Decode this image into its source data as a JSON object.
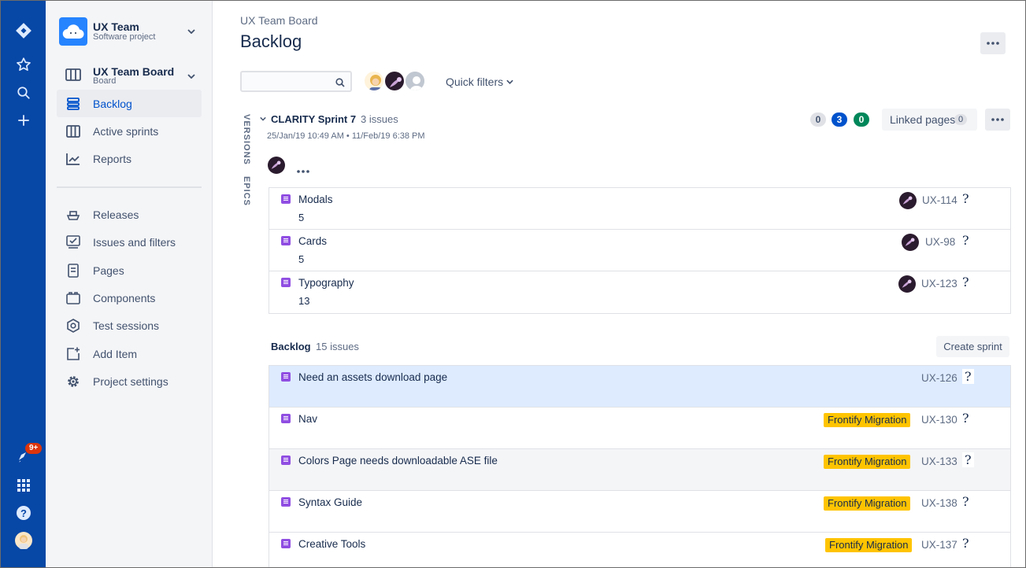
{
  "global_nav": {
    "notification_badge": "9+",
    "icons": [
      "jira-logo-icon",
      "star-icon",
      "search-icon",
      "plus-icon",
      "notification-icon",
      "app-switcher-icon",
      "help-icon",
      "user-avatar"
    ]
  },
  "sidebar": {
    "project": {
      "name": "UX Team",
      "type": "Software project"
    },
    "board": {
      "name": "UX Team Board",
      "type": "Board"
    },
    "items": [
      {
        "label": "Backlog",
        "icon": "backlog-icon",
        "active": true
      },
      {
        "label": "Active sprints",
        "icon": "board-icon",
        "active": false
      },
      {
        "label": "Reports",
        "icon": "reports-icon",
        "active": false
      },
      {
        "label": "Releases",
        "icon": "ship-icon",
        "active": false
      },
      {
        "label": "Issues and filters",
        "icon": "issues-icon",
        "active": false
      },
      {
        "label": "Pages",
        "icon": "page-icon",
        "active": false
      },
      {
        "label": "Components",
        "icon": "component-icon",
        "active": false
      },
      {
        "label": "Test sessions",
        "icon": "test-session-icon",
        "active": false
      },
      {
        "label": "Add Item",
        "icon": "add-item-icon",
        "active": false
      },
      {
        "label": "Project settings",
        "icon": "gear-icon",
        "active": false
      }
    ]
  },
  "header": {
    "breadcrumb": "UX Team Board",
    "title": "Backlog",
    "search_placeholder": "",
    "quick_filters": "Quick filters"
  },
  "side_tabs": {
    "versions": "VERSIONS",
    "epics": "EPICS"
  },
  "sprint": {
    "name": "CLARITY Sprint 7",
    "count": "3 issues",
    "dates": "25/Jan/19 10:49 AM • 11/Feb/19 6:38 PM",
    "status_counts": {
      "todo": "0",
      "in_progress": "3",
      "done": "0"
    },
    "linked_pages_label": "Linked pages",
    "linked_pages_count": "0",
    "issues": [
      {
        "summary": "Modals",
        "estimate": "5",
        "key": "UX-114"
      },
      {
        "summary": "Cards",
        "estimate": "5",
        "key": "UX-98"
      },
      {
        "summary": "Typography",
        "estimate": "13",
        "key": "UX-123"
      }
    ]
  },
  "backlog": {
    "title": "Backlog",
    "count": "15 issues",
    "create_sprint": "Create sprint",
    "issues": [
      {
        "summary": "Need an assets download page",
        "epic": "",
        "key": "UX-126"
      },
      {
        "summary": "Nav",
        "epic": "Frontify Migration",
        "key": "UX-130"
      },
      {
        "summary": "Colors Page needs downloadable ASE file",
        "epic": "Frontify Migration",
        "key": "UX-133"
      },
      {
        "summary": "Syntax Guide",
        "epic": "Frontify Migration",
        "key": "UX-138"
      },
      {
        "summary": "Creative Tools",
        "epic": "Frontify Migration",
        "key": "UX-137"
      }
    ]
  },
  "colors": {
    "nav_bg": "#0747A6",
    "accent": "#0052CC",
    "epic": "#FFC400",
    "story": "#904EE2",
    "done": "#00875A",
    "selected_row": "#DEEBFF"
  }
}
